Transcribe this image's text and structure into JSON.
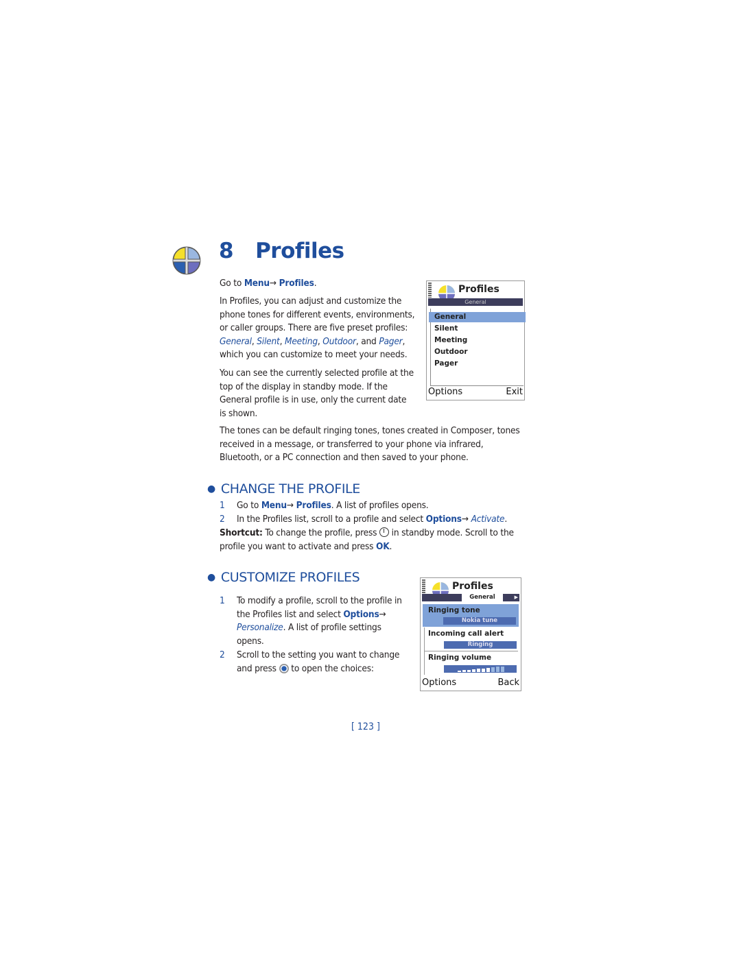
{
  "chapter": {
    "number": "8",
    "title": "Profiles"
  },
  "intro": {
    "goto": {
      "prefix": "Go to ",
      "menu": "Menu",
      "arrow": "→ ",
      "profiles": "Profiles",
      "end": "."
    },
    "p1": {
      "l1": "In Profiles, you can adjust and customize the",
      "l2": "phone tones for different events, environments,",
      "l3": "or caller groups. There are five preset profiles:",
      "profiles": [
        "General",
        "Silent",
        "Meeting",
        "Outdoor",
        "Pager"
      ],
      "and": "and",
      "l5": "which you can customize to meet your needs."
    },
    "p2": [
      "You can see the currently selected profile at the",
      "top of the display in standby mode. If the",
      "General profile is in use, only the current date",
      "is shown."
    ],
    "p3": [
      "The tones can be default ringing tones, tones created in Composer, tones",
      "received in a message, or transferred to your phone via infrared,",
      "Bluetooth, or a PC connection and then saved to your phone."
    ]
  },
  "screen1": {
    "title": "Profiles",
    "subtitle": "General",
    "items": [
      "General",
      "Silent",
      "Meeting",
      "Outdoor",
      "Pager"
    ],
    "selected": "General",
    "left_soft": "Options",
    "right_soft": "Exit"
  },
  "change": {
    "heading": "CHANGE THE PROFILE",
    "step1": {
      "n": "1",
      "a": "Go to ",
      "menu": "Menu",
      "arrow": "→ ",
      "profiles": "Profiles",
      "rest": ". A list of profiles opens."
    },
    "step2": {
      "n": "2",
      "a": "In the Profiles list, scroll to a profile and select ",
      "options": "Options",
      "arrow": "→ ",
      "activate": "Activate",
      "end": "."
    },
    "shortcut": {
      "label": "Shortcut:",
      "a": " To change the profile, press ",
      "b": " in standby mode. Scroll to the",
      "l2a": "profile you want to activate and press ",
      "ok": "OK",
      "end": "."
    }
  },
  "customize": {
    "heading": "CUSTOMIZE PROFILES",
    "step1": {
      "n": "1",
      "l1": "To modify a profile, scroll to the profile in",
      "l2a": "the Profiles list and select ",
      "options": "Options",
      "arrow": "→",
      "personalize": "Personalize",
      "l3": ". A list of profile settings",
      "l4": "opens."
    },
    "step2": {
      "n": "2",
      "l1": "Scroll to the setting you want to change",
      "l2a": "and press ",
      "l2b": " to open the choices:"
    }
  },
  "screen2": {
    "title": "Profiles",
    "subtitle": "General",
    "settings": [
      {
        "label": "Ringing tone",
        "value": "Nokia tune"
      },
      {
        "label": "Incoming call alert",
        "value": "Ringing"
      },
      {
        "label": "Ringing volume",
        "value": ""
      }
    ],
    "volume_level": 0.7,
    "left_soft": "Options",
    "right_soft": "Back"
  },
  "page_number": "[ 123 ]",
  "colors": {
    "accent": "#1f4e9c",
    "selection": "#7fa2d8",
    "header_bar": "#3d3d5c"
  }
}
